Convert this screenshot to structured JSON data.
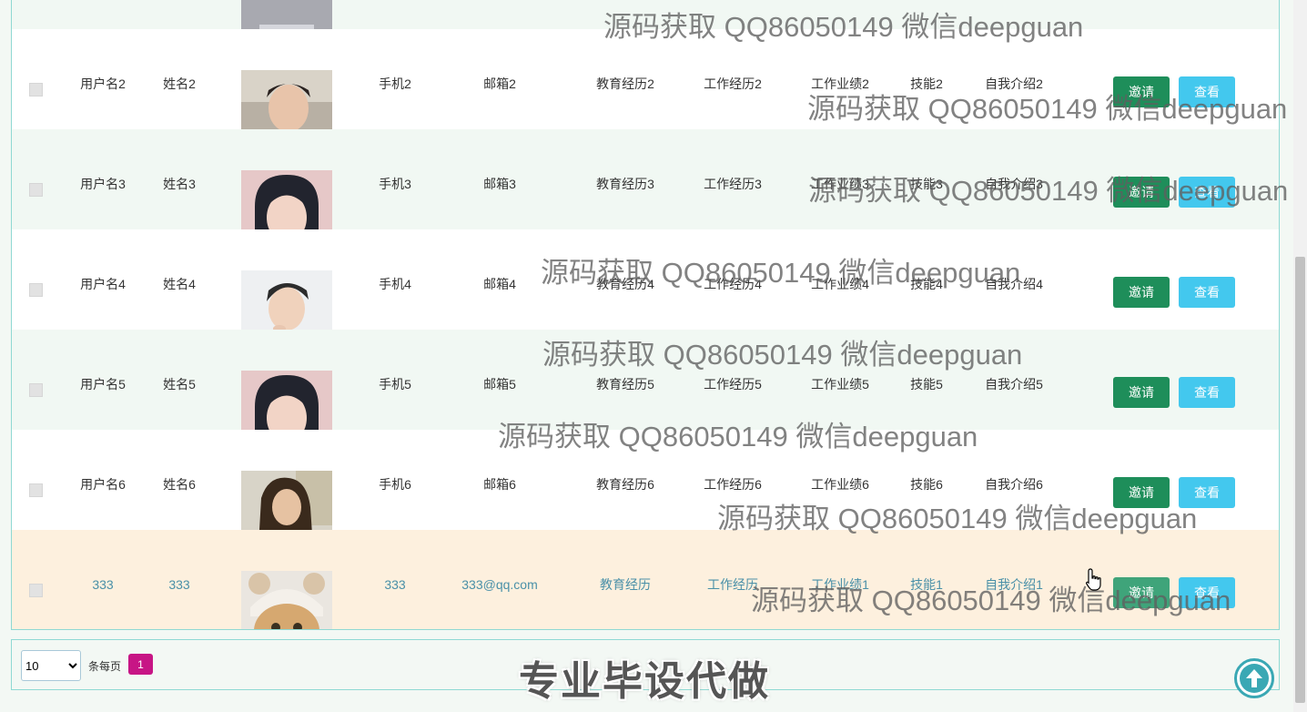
{
  "rows": [
    {
      "checked": false,
      "username": "用户名2",
      "name": "姓名2",
      "photo": "young man selfie",
      "phone": "手机2",
      "email": "邮箱2",
      "education": "教育经历2",
      "work_history": "工作经历2",
      "achievements": "工作业绩2",
      "skills": "技能2",
      "intro": "自我介绍2"
    },
    {
      "checked": false,
      "username": "用户名3",
      "name": "姓名3",
      "photo": "woman short dark hair",
      "phone": "手机3",
      "email": "邮箱3",
      "education": "教育经历3",
      "work_history": "工作经历3",
      "achievements": "工作业绩3",
      "skills": "技能3",
      "intro": "自我介绍3"
    },
    {
      "checked": false,
      "username": "用户名4",
      "name": "姓名4",
      "photo": "young man white shirt",
      "phone": "手机4",
      "email": "邮箱4",
      "education": "教育经历4",
      "work_history": "工作经历4",
      "achievements": "工作业绩4",
      "skills": "技能4",
      "intro": "自我介绍4"
    },
    {
      "checked": false,
      "username": "用户名5",
      "name": "姓名5",
      "photo": "woman short dark hair",
      "phone": "手机5",
      "email": "邮箱5",
      "education": "教育经历5",
      "work_history": "工作经历5",
      "achievements": "工作业绩5",
      "skills": "技能5",
      "intro": "自我介绍5"
    },
    {
      "checked": false,
      "username": "用户名6",
      "name": "姓名6",
      "photo": "woman long hair outdoors",
      "phone": "手机6",
      "email": "邮箱6",
      "education": "教育经历6",
      "work_history": "工作经历6",
      "achievements": "工作业绩6",
      "skills": "技能6",
      "intro": "自我介绍6"
    },
    {
      "checked": false,
      "username": "333",
      "name": "333",
      "photo": "cat with bear hat",
      "phone": "333",
      "email": "333@qq.com",
      "education": "教育经历",
      "work_history": "工作经历",
      "achievements": "工作业绩1",
      "skills": "技能1",
      "intro": "自我介绍1"
    }
  ],
  "actions": {
    "invite_label": "邀请",
    "view_label": "查看"
  },
  "watermarks": [
    "源码获取 QQ86050149 微信deepguan",
    "源码获取 QQ86050149 微信deepguan",
    "源码获取 QQ86050149 微信deepguan",
    "源码获取 QQ86050149 微信deepguan",
    "源码获取 QQ86050149 微信deepguan",
    "源码获取 QQ86050149 微信deepguan",
    "源码获取 QQ86050149 微信deepguan",
    "源码获取 QQ86050149 微信deepguan"
  ],
  "pagination": {
    "page_size": "10",
    "page_size_options": [
      "10"
    ],
    "per_page_label": "条每页",
    "current_page": "1"
  },
  "promo_text": "专业毕设代做",
  "colors": {
    "accent_pink": "#c71585",
    "invite_green": "#1e8e5a",
    "view_blue": "#43c8ee",
    "highlight_row": "#fdf0de",
    "border_teal": "#8fd9d3"
  },
  "icons": {
    "back_to_top": "arrow-up-circle-icon",
    "cursor": "hand-pointer-icon"
  }
}
